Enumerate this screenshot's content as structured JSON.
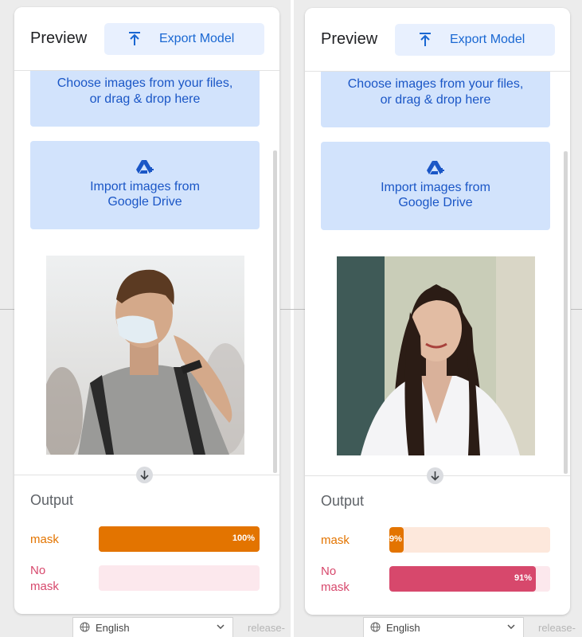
{
  "panels": [
    {
      "header": {
        "title": "Preview",
        "export_label": "Export Model"
      },
      "upload": {
        "line1": "Choose images from your files,",
        "line2": "or drag & drop here"
      },
      "drive": {
        "line1": "Import images from",
        "line2": "Google Drive"
      },
      "photo": {
        "subject": "man wearing face mask"
      },
      "output": {
        "title": "Output",
        "classes": [
          {
            "label_line1": "mask",
            "label_line2": "",
            "value_text": "100%",
            "value": 1.0,
            "color": "#e37400",
            "track_color": "#e37400",
            "label_color": "#e37400"
          },
          {
            "label_line1": "No",
            "label_line2": "mask",
            "value_text": "",
            "value": 0.0,
            "color": "#d7486c",
            "track_color": "#fce8ed",
            "label_color": "#d7486c"
          }
        ]
      }
    },
    {
      "header": {
        "title": "Preview",
        "export_label": "Export Model"
      },
      "upload": {
        "line1": "Choose images from your files,",
        "line2": "or drag & drop here"
      },
      "drive": {
        "line1": "Import images from",
        "line2": "Google Drive"
      },
      "photo": {
        "subject": "woman without mask"
      },
      "output": {
        "title": "Output",
        "classes": [
          {
            "label_line1": "mask",
            "label_line2": "",
            "value_text": "9%",
            "value": 0.09,
            "color": "#e37400",
            "track_color": "#fde8dc",
            "label_color": "#e37400"
          },
          {
            "label_line1": "No",
            "label_line2": "mask",
            "value_text": "91%",
            "value": 0.91,
            "color": "#d7486c",
            "track_color": "#fce8ed",
            "label_color": "#d7486c"
          }
        ]
      }
    }
  ],
  "footer": {
    "language": "English",
    "release_text": "release-"
  },
  "icons": {
    "export": "upload-arrow-icon",
    "drive": "google-drive-add-icon",
    "scroll": "arrow-down-circle-icon",
    "globe": "globe-icon",
    "chevron": "chevron-down-icon"
  },
  "colors": {
    "accent": "#1967d2",
    "button_bg": "#e8f0fe",
    "upload_bg": "#d2e3fc",
    "mask": "#e37400",
    "no_mask": "#d7486c"
  }
}
